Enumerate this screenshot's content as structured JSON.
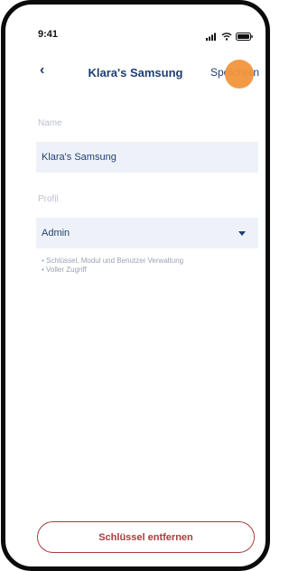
{
  "status_bar": {
    "time": "9:41"
  },
  "nav": {
    "back_label": "‹",
    "title": "Klara's Samsung",
    "save_label": "Speichern"
  },
  "form": {
    "name_label": "Name",
    "name_value": "Klara's Samsung",
    "profile_label": "Profil",
    "profile_value": "Admin",
    "profile_details": [
      "Schlüssel, Modul und Benutzer Verwaltung",
      "Voller Zugriff"
    ]
  },
  "actions": {
    "remove_label": "Schlüssel entfernen"
  },
  "colors": {
    "primary": "#1f3f73",
    "danger": "#a63d3f",
    "touch": "#f2953b",
    "field_bg": "#eef2f8"
  },
  "icons": [
    "signal-icon",
    "wifi-icon",
    "battery-icon",
    "chevron-left-icon",
    "chevron-down-icon"
  ]
}
